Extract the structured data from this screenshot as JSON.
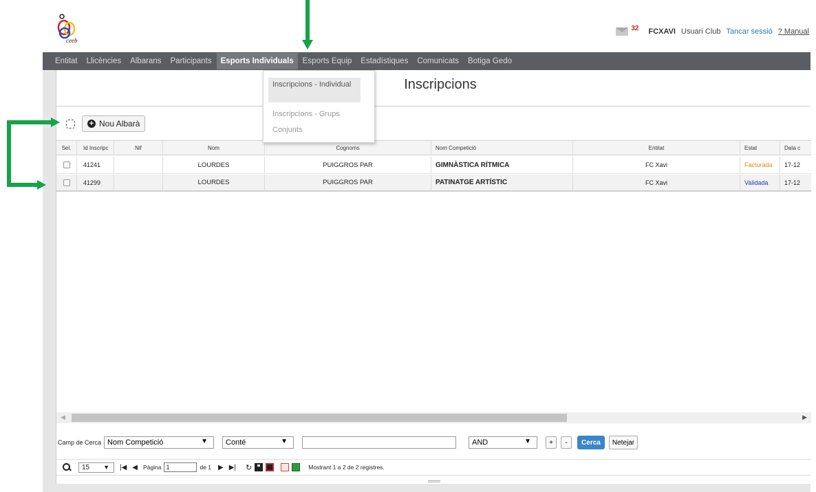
{
  "header": {
    "logo_text": "ceeb",
    "mail_count": "32",
    "user_code": "FCXAVI",
    "user_role": "Usuari Club",
    "logout": "Tancar sessió",
    "manual": "? Manual"
  },
  "nav": {
    "items": [
      "Entitat",
      "Llicències",
      "Albarans",
      "Participants",
      "Esports Individuals",
      "Esports Equip",
      "Estadístiques",
      "Comunicats",
      "Botiga Gedo"
    ],
    "active": "Esports Individuals"
  },
  "menu": {
    "items": [
      "Inscripcions - Individual",
      "Inscripcions - Grups",
      "Conjunts"
    ]
  },
  "page_title": "Inscripcions",
  "toolbar": {
    "new_button": "Nou Albarà"
  },
  "grid": {
    "columns": [
      "Sel.",
      "Id Inscripc",
      "Nif",
      "Nom",
      "Cognoms",
      "Nom Competició",
      "Entitat",
      "Estat",
      "Data c"
    ],
    "rows": [
      {
        "id": "41241",
        "nif": "",
        "nom": "LOURDES",
        "cognoms": "PUIGGROS PAR",
        "competicio": "GIMNÀSTICA RÍTMICA",
        "entitat": "FC Xavi",
        "estat": "Facturada",
        "data": "17-12"
      },
      {
        "id": "41299",
        "nif": "",
        "nom": "LOURDES",
        "cognoms": "PUIGGROS PAR",
        "competicio": "PATINATGE ARTÍSTIC",
        "entitat": "FC Xavi",
        "estat": "Validada",
        "data": "17-12"
      }
    ]
  },
  "search": {
    "label": "Camp de Cerca",
    "field": "Nom Competició",
    "operator": "Conté",
    "value": "",
    "logic": "AND",
    "add": "+",
    "remove": "-",
    "search_button": "Cerca",
    "clear_button": "Netejar"
  },
  "pager": {
    "page_size": "15",
    "page_label": "Pàgina",
    "page_value": "1",
    "of_label": "de 1",
    "info": "Mostrant 1 a 2 de 2 registres."
  },
  "colors": {
    "nav_bg": "#5a5e63",
    "accent": "#3a86c8",
    "status_facturada": "#e8861a",
    "status_validada": "#2233cc",
    "annotation_arrow": "#15a34a"
  },
  "icons": [
    "ceeb-logo-icon",
    "mail-icon",
    "plus-circle-icon",
    "search-icon",
    "first-page-icon",
    "prev-page-icon",
    "next-page-icon",
    "last-page-icon",
    "reload-icon",
    "save-icon",
    "save-all-icon",
    "pdf-icon",
    "excel-icon"
  ]
}
